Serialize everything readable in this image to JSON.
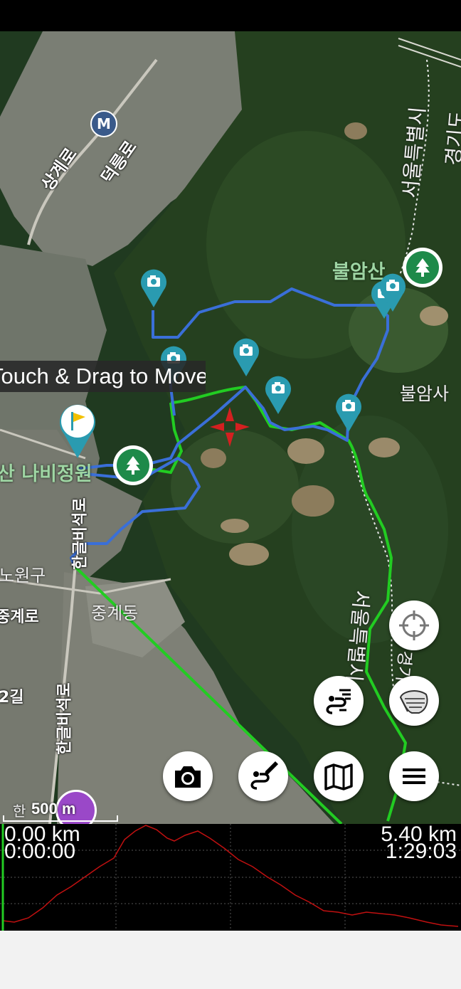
{
  "map": {
    "hint": "Touch & Drag to Move",
    "scale_label": "500 m",
    "labels": {
      "metro": "M",
      "road_1": "상계로",
      "road_2": "덕릉로",
      "bulamsa_green": "불암산",
      "bulamsa_white": "불암사",
      "seoul_1": "서울특별시",
      "seoul_2": "서울특별시",
      "gyeonggi_top": "경기도",
      "gyeonggi_bottom": "경기",
      "butterfly": "산 나비정원",
      "hangeulbiseok": "한글비석로",
      "nowon": "노원구",
      "junggye": "중계동",
      "junggyero": "중계로",
      "gil": "2길",
      "hangeulbiseok_2": "한글비석로",
      "bottom_partial": "한"
    },
    "colors": {
      "track_blue": "#3a6fd8",
      "track_green": "#22cc22",
      "marker": "#2a9bb0",
      "park_green": "#1e8a4a"
    }
  },
  "profile": {
    "start_distance": "0.00 km",
    "start_time": "0:00:00",
    "end_distance": "5.40 km",
    "end_time": "1:29:03"
  },
  "buttons": {
    "locate": "crosshair-icon",
    "layers": "layers-icon",
    "track": "track-list-icon",
    "camera": "camera-icon",
    "draw": "draw-route-icon",
    "map": "map-icon",
    "menu": "menu-icon"
  }
}
